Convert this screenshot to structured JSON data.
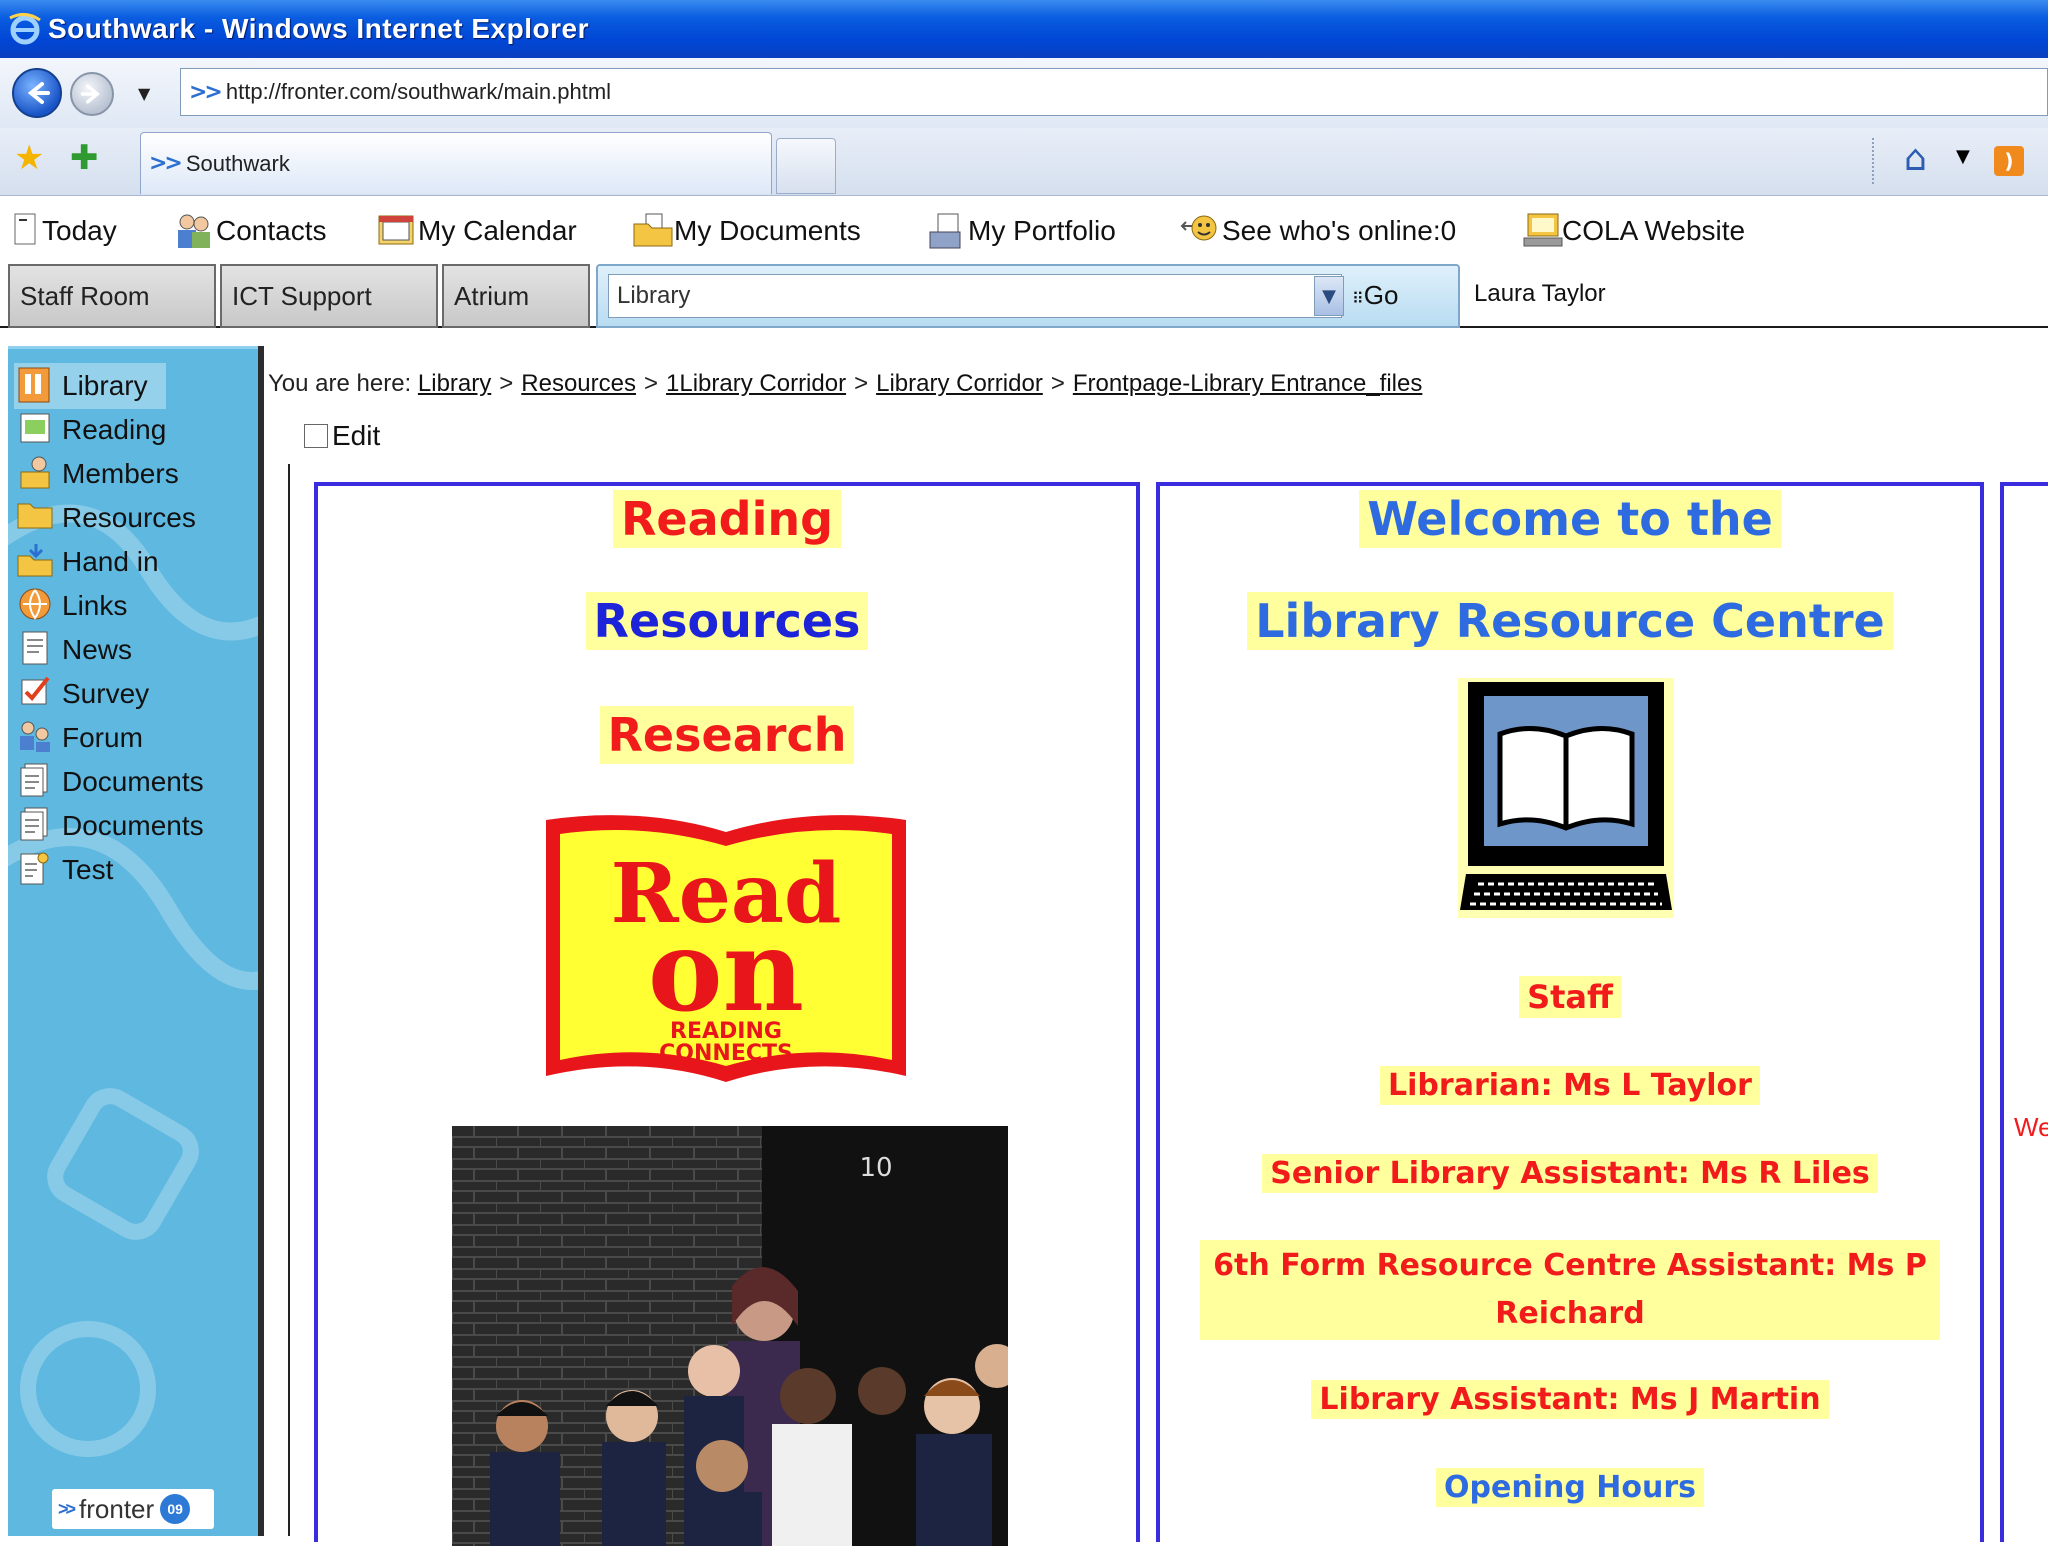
{
  "window": {
    "title": "Southwark - Windows Internet Explorer"
  },
  "address": {
    "url": "http://fronter.com/southwark/main.phtml"
  },
  "tab": {
    "label": "Southwark"
  },
  "topnav": [
    {
      "label": "Today",
      "icon": "today-icon"
    },
    {
      "label": "Contacts",
      "icon": "contacts-icon"
    },
    {
      "label": "My Calendar",
      "icon": "calendar-icon"
    },
    {
      "label": "My Documents",
      "icon": "folder-icon"
    },
    {
      "label": "My Portfolio",
      "icon": "portfolio-icon"
    },
    {
      "label": "See who's online:0",
      "icon": "online-icon"
    },
    {
      "label": "COLA Website",
      "icon": "website-icon"
    }
  ],
  "rooms": {
    "tabs": [
      "Staff Room",
      "ICT Support",
      "Atrium"
    ],
    "selected": "Library",
    "go_label": "Go",
    "user": "Laura Taylor"
  },
  "sidebar": {
    "items": [
      {
        "label": "Library",
        "icon": "library-icon",
        "active": true
      },
      {
        "label": "Reading",
        "icon": "reading-icon"
      },
      {
        "label": "Members",
        "icon": "members-icon"
      },
      {
        "label": "Resources",
        "icon": "folder-icon"
      },
      {
        "label": "Hand in",
        "icon": "hand-in-icon"
      },
      {
        "label": "Links",
        "icon": "links-icon"
      },
      {
        "label": "News",
        "icon": "news-icon"
      },
      {
        "label": "Survey",
        "icon": "survey-icon"
      },
      {
        "label": "Forum",
        "icon": "forum-icon"
      },
      {
        "label": "Documents",
        "icon": "document-icon"
      },
      {
        "label": "Documents",
        "icon": "document-icon"
      },
      {
        "label": "Test",
        "icon": "test-icon"
      }
    ],
    "logo_text": "fronter",
    "logo_badge": "09"
  },
  "breadcrumb": {
    "prefix": "You are here:",
    "items": [
      "Library",
      "Resources",
      "1Library Corridor",
      "Library Corridor",
      "Frontpage-Library Entrance_files"
    ]
  },
  "edit_label": "Edit",
  "left_panel": {
    "line1": "Reading",
    "line2": "Resources",
    "line3": "Research",
    "book_big1": "Read",
    "book_big2": "on",
    "book_small1": "READING",
    "book_small2": "CONNECTS",
    "door_number": "10"
  },
  "mid_panel": {
    "title1": "Welcome to the",
    "title2": "Library Resource Centre",
    "staff_heading": "Staff",
    "staff": [
      "Librarian: Ms L Taylor",
      "Senior Library Assistant: Ms R Liles",
      "6th Form Resource Centre Assistant: Ms P Reichard",
      "Library Assistant: Ms J Martin"
    ],
    "opening": "Opening Hours"
  },
  "right_panel": {
    "peek": "We"
  }
}
